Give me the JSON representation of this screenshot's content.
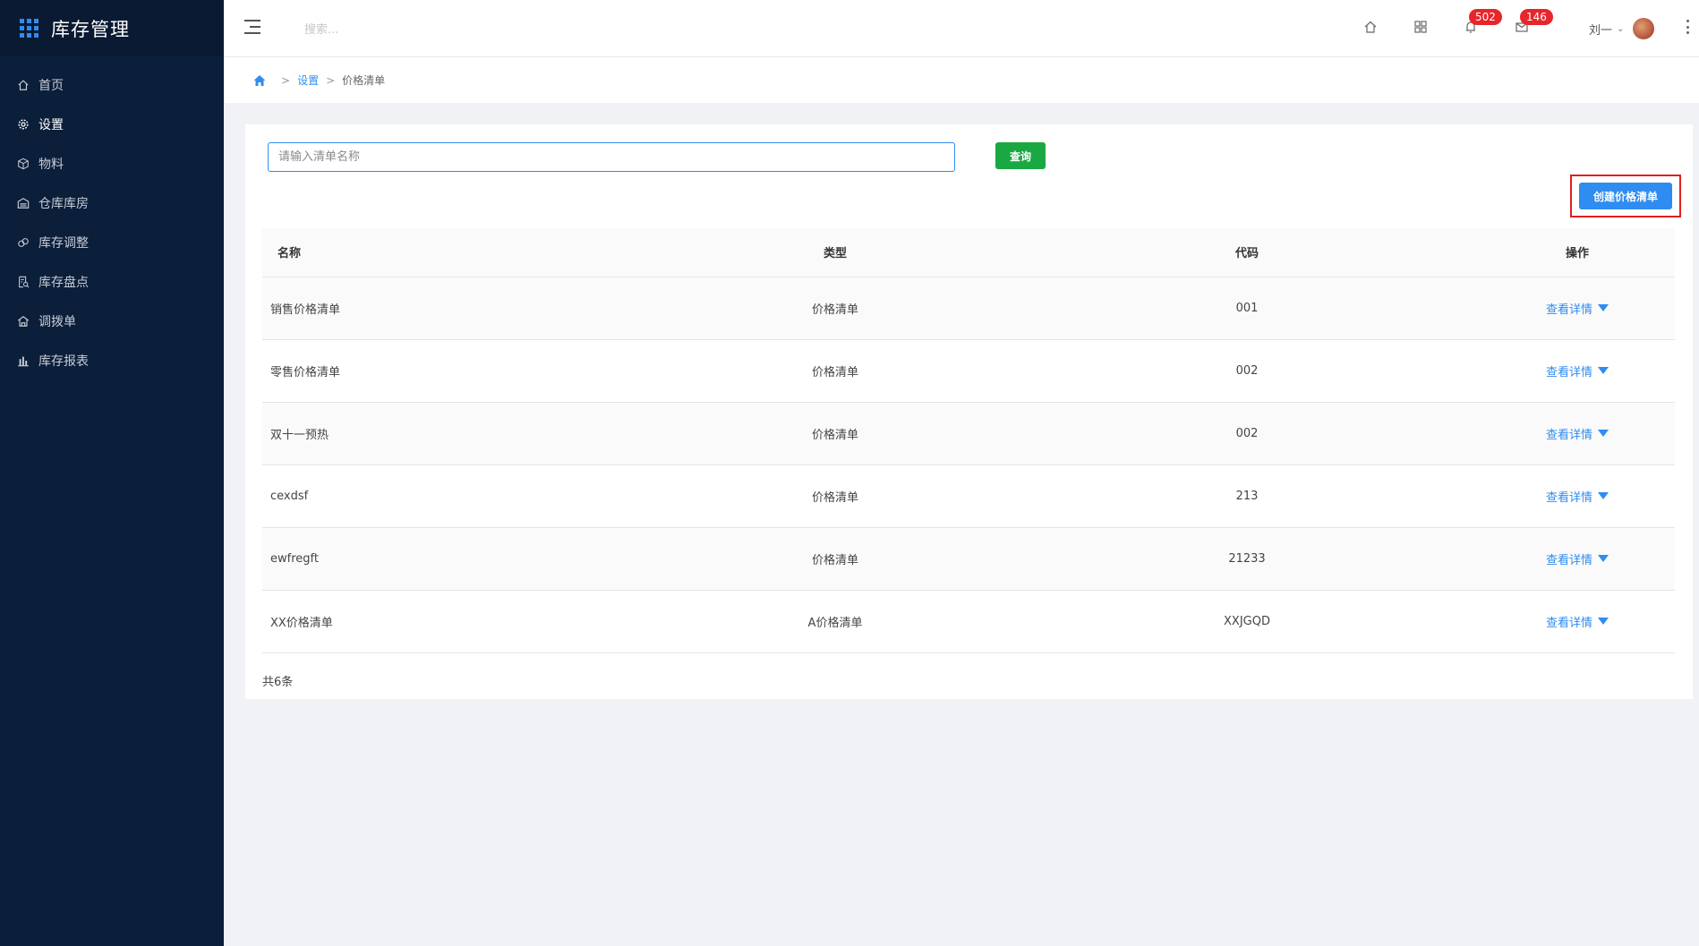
{
  "app": {
    "title": "库存管理"
  },
  "sidebar": {
    "items": [
      {
        "label": "首页",
        "icon": "home-icon"
      },
      {
        "label": "设置",
        "icon": "gear-icon",
        "active": true
      },
      {
        "label": "物料",
        "icon": "cube-icon"
      },
      {
        "label": "仓库库房",
        "icon": "warehouse-icon"
      },
      {
        "label": "库存调整",
        "icon": "adjust-icon"
      },
      {
        "label": "库存盘点",
        "icon": "inventory-check-icon"
      },
      {
        "label": "调拨单",
        "icon": "transfer-icon"
      },
      {
        "label": "库存报表",
        "icon": "bar-chart-icon"
      }
    ]
  },
  "header": {
    "search_placeholder": "搜索...",
    "notifications_count": "502",
    "messages_count": "146",
    "user_name": "刘一"
  },
  "breadcrumb": {
    "section": "设置",
    "current": "价格清单"
  },
  "toolbar": {
    "name_placeholder": "请输入清单名称",
    "query_label": "查询",
    "create_label": "创建价格清单"
  },
  "table": {
    "columns": [
      "名称",
      "类型",
      "代码",
      "操作"
    ],
    "rows": [
      {
        "name": "销售价格清单",
        "type": "价格清单",
        "code": "001",
        "action": "查看详情"
      },
      {
        "name": "零售价格清单",
        "type": "价格清单",
        "code": "002",
        "action": "查看详情"
      },
      {
        "name": "双十一预热",
        "type": "价格清单",
        "code": "002",
        "action": "查看详情"
      },
      {
        "name": "cexdsf",
        "type": "价格清单",
        "code": "213",
        "action": "查看详情"
      },
      {
        "name": "ewfregft",
        "type": "价格清单",
        "code": "21233",
        "action": "查看详情"
      },
      {
        "name": "XX价格清单",
        "type": "A价格清单",
        "code": "XXJGQD",
        "action": "查看详情"
      }
    ],
    "total_text": "共6条"
  },
  "colors": {
    "primary": "#2f8cf0",
    "success": "#1aa843",
    "sidebar": "#0b1e3a",
    "badge": "#e8252a",
    "highlight_border": "#e02020"
  }
}
